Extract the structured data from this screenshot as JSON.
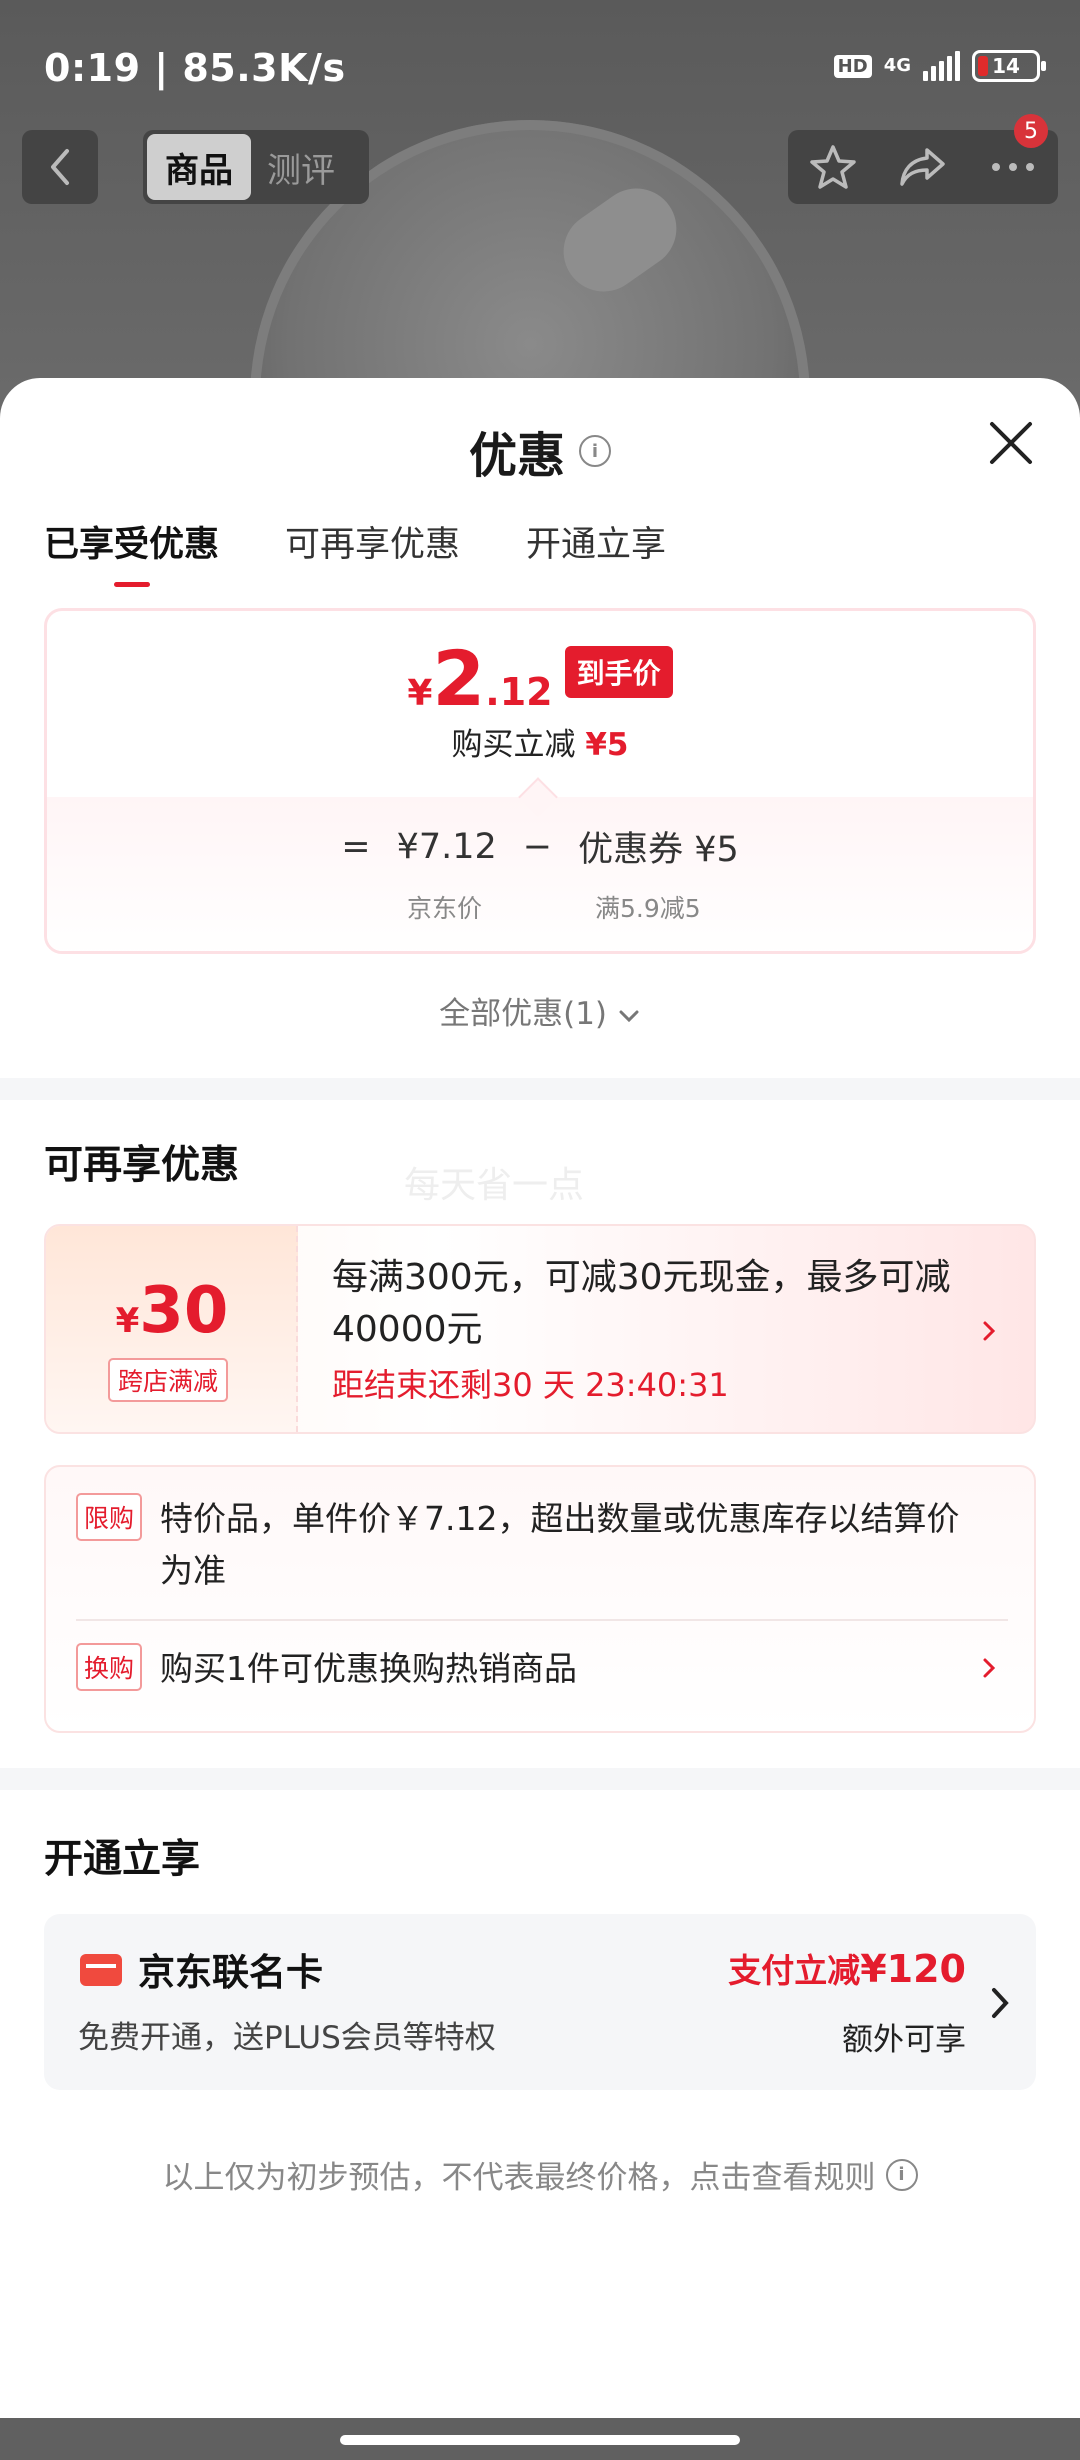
{
  "status": {
    "time": "0:19 | 85.3K/s",
    "hd": "HD",
    "network": "4G",
    "battery": "14"
  },
  "topbar": {
    "tabs": [
      {
        "label": "商品",
        "active": true
      },
      {
        "label": "测评",
        "active": false
      }
    ],
    "badge_count": "5",
    "icons": [
      "back-icon",
      "star-icon",
      "share-icon",
      "more-icon"
    ]
  },
  "sheet": {
    "title": "优惠",
    "tabs": [
      {
        "label": "已享受优惠",
        "active": true
      },
      {
        "label": "可再享优惠",
        "active": false
      },
      {
        "label": "开通立享",
        "active": false
      }
    ],
    "price": {
      "currency": "¥",
      "integer": "2",
      "decimal": ".12",
      "tag": "到手价",
      "sub_prefix": "购买立减",
      "sub_value": "¥5"
    },
    "formula": {
      "equals": "=",
      "base_price": "¥7.12",
      "minus": "−",
      "coupon": "优惠券 ¥5",
      "base_label": "京东价",
      "coupon_label": "满5.9减5"
    },
    "all_deals": "全部优惠(1)"
  },
  "more_section": {
    "title": "可再享优惠",
    "watermark": "每天省一点",
    "coupon": {
      "currency": "¥",
      "amount": "30",
      "tag": "跨店满减",
      "text": "每满300元，可减30元现金，最多可减40000元",
      "countdown": "距结束还剩30 天 23:40:31"
    },
    "rules": [
      {
        "tag": "限购",
        "text": "特价品，单件价￥7.12，超出数量或优惠库存以结算价为准"
      },
      {
        "tag": "换购",
        "text": "购买1件可优惠换购热销商品"
      }
    ]
  },
  "open_section": {
    "title": "开通立享",
    "card": {
      "name": "京东联名卡",
      "desc": "免费开通，送PLUS会员等特权",
      "benefit_prefix": "支付立减",
      "benefit_value": "¥120",
      "benefit_note": "额外可享"
    }
  },
  "disclaimer": "以上仅为初步预估，不代表最终价格，点击查看规则",
  "colors": {
    "accent": "#e41c2d",
    "sheet_bg": "#ffffff",
    "divider": "#f5f6f8"
  }
}
